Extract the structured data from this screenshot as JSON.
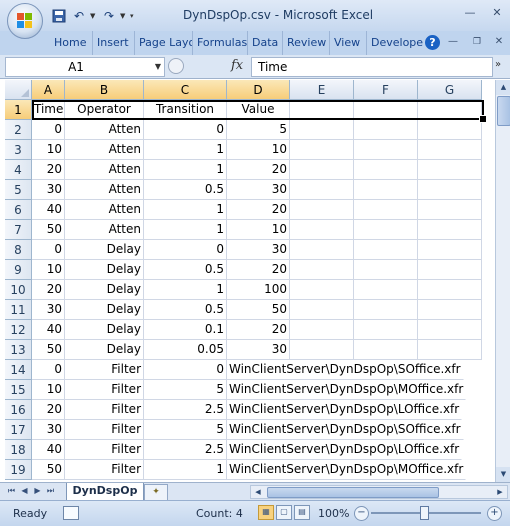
{
  "window": {
    "title": "DynDspOp.csv - Microsoft Excel"
  },
  "ribbon": {
    "tabs": [
      "Home",
      "Insert",
      "Page Layo",
      "Formulas",
      "Data",
      "Review",
      "View",
      "Develope"
    ]
  },
  "formula_bar": {
    "name_box": "A1",
    "fx": "fx",
    "value": "Time"
  },
  "grid": {
    "columns": [
      "A",
      "B",
      "C",
      "D",
      "E",
      "F",
      "G"
    ],
    "rows": [
      "1",
      "2",
      "3",
      "4",
      "5",
      "6",
      "7",
      "8",
      "9",
      "10",
      "11",
      "12",
      "13",
      "14",
      "15",
      "16",
      "17",
      "18",
      "19"
    ],
    "header": [
      "Time",
      "Operator",
      "Transition",
      "Value"
    ],
    "data": [
      [
        "0",
        "Atten",
        "0",
        "5"
      ],
      [
        "10",
        "Atten",
        "1",
        "10"
      ],
      [
        "20",
        "Atten",
        "1",
        "20"
      ],
      [
        "30",
        "Atten",
        "0.5",
        "30"
      ],
      [
        "40",
        "Atten",
        "1",
        "20"
      ],
      [
        "50",
        "Atten",
        "1",
        "10"
      ],
      [
        "0",
        "Delay",
        "0",
        "30"
      ],
      [
        "10",
        "Delay",
        "0.5",
        "20"
      ],
      [
        "20",
        "Delay",
        "1",
        "100"
      ],
      [
        "30",
        "Delay",
        "0.5",
        "50"
      ],
      [
        "40",
        "Delay",
        "0.1",
        "20"
      ],
      [
        "50",
        "Delay",
        "0.05",
        "30"
      ],
      [
        "0",
        "Filter",
        "0",
        "WinClientServer\\DynDspOp\\SOffice.xfr"
      ],
      [
        "10",
        "Filter",
        "5",
        "WinClientServer\\DynDspOp\\MOffice.xfr"
      ],
      [
        "20",
        "Filter",
        "2.5",
        "WinClientServer\\DynDspOp\\LOffice.xfr"
      ],
      [
        "30",
        "Filter",
        "5",
        "WinClientServer\\DynDspOp\\SOffice.xfr"
      ],
      [
        "40",
        "Filter",
        "2.5",
        "WinClientServer\\DynDspOp\\LOffice.xfr"
      ],
      [
        "50",
        "Filter",
        "1",
        "WinClientServer\\DynDspOp\\MOffice.xfr"
      ]
    ]
  },
  "sheets": {
    "active": "DynDspOp"
  },
  "status": {
    "ready": "Ready",
    "count": "Count: 4",
    "zoom": "100%"
  },
  "icons": {
    "save": "save-icon",
    "undo": "undo-icon",
    "redo": "redo-icon",
    "help": "help-icon",
    "fx": "fx-icon",
    "new_sheet": "insert-worksheet-icon"
  },
  "colors": {
    "selection_header": "#f7cd79",
    "ribbon": "#bfd4ee",
    "gridline": "#d0d7e5"
  }
}
